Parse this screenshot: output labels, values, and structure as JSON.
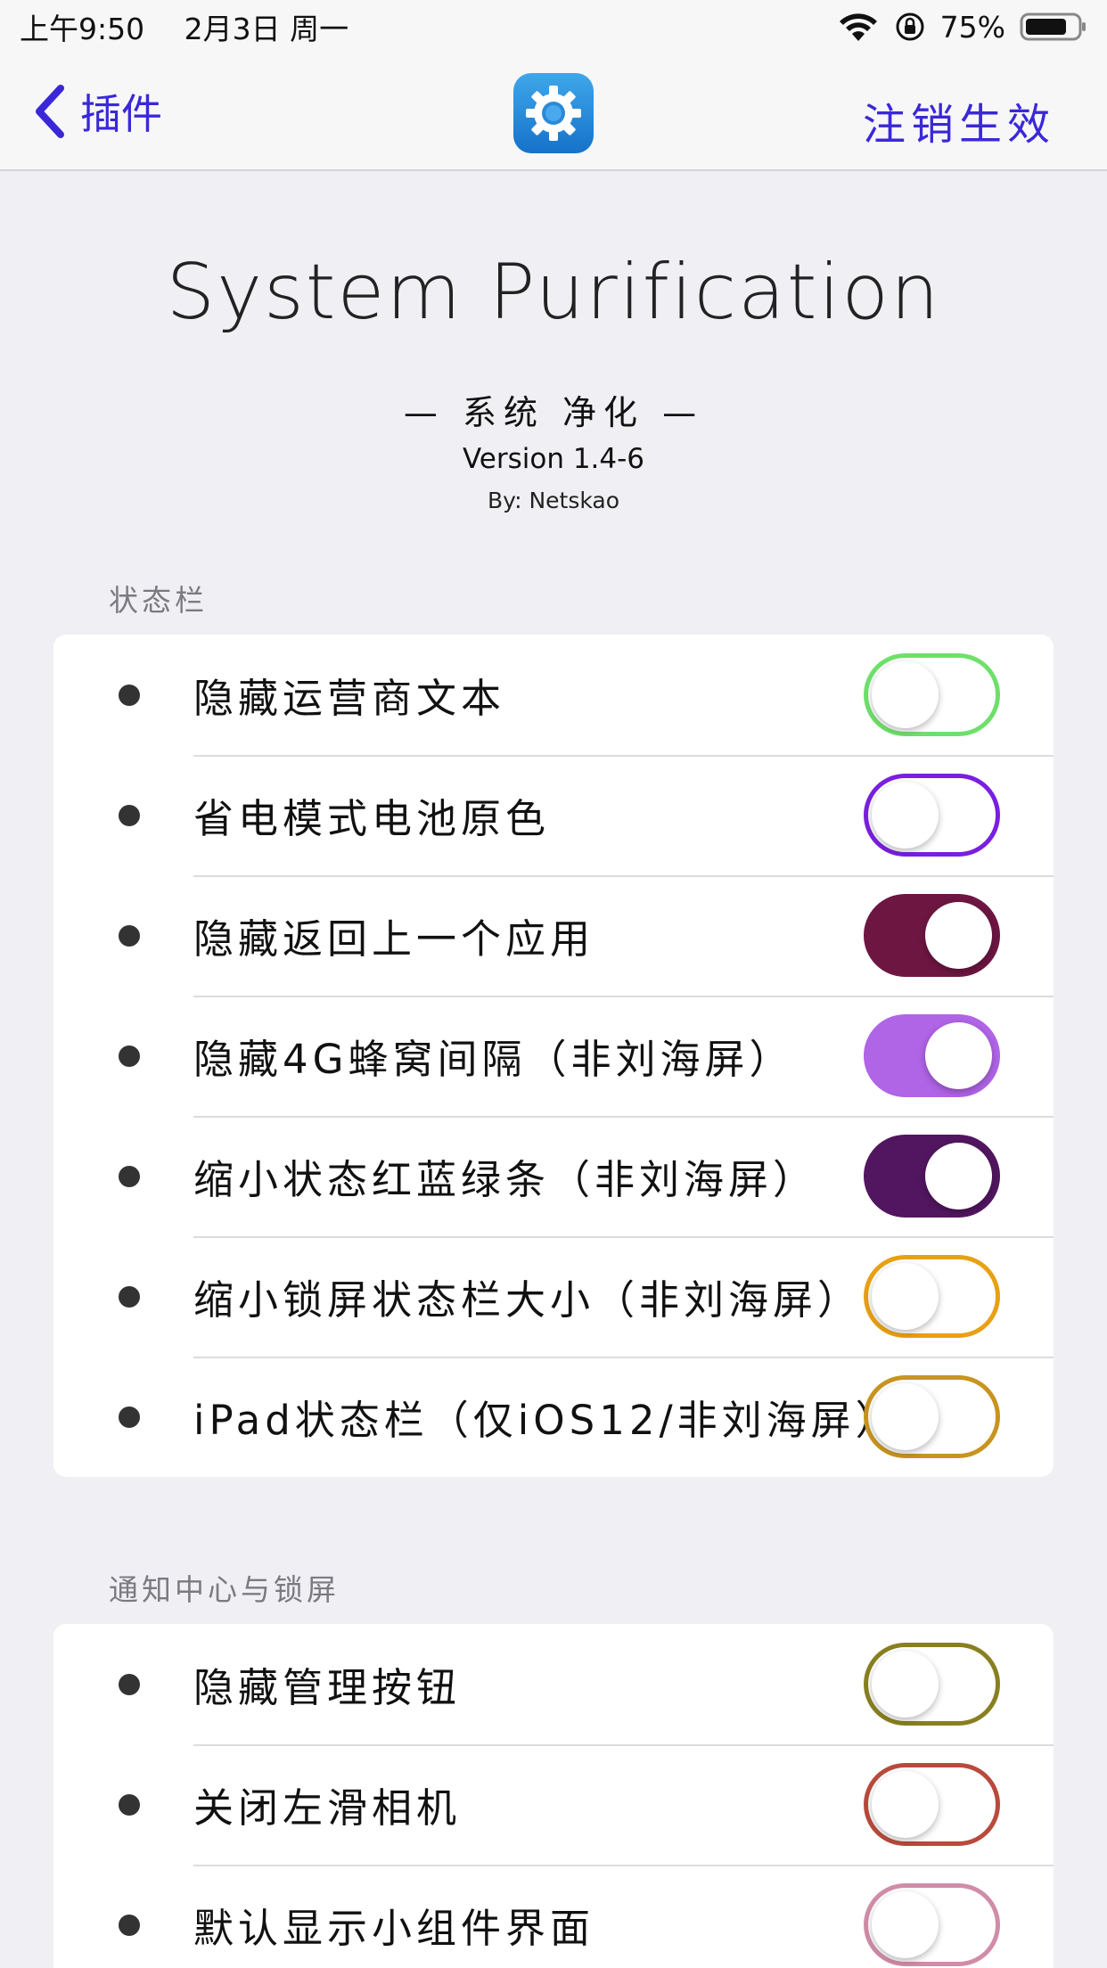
{
  "status_bar": {
    "time": "上午9:50",
    "date": "2月3日 周一",
    "battery": "75%"
  },
  "nav": {
    "back_label": "插件",
    "action_label": "注销生效",
    "app_icon": "gear-icon"
  },
  "header": {
    "title": "System Purification",
    "subtitle": "— 系统 净化 —",
    "version": "Version 1.4-6",
    "author": "By: Netskao"
  },
  "sections": [
    {
      "title": "状态栏",
      "items": [
        {
          "label": "隐藏运营商文本",
          "on": false,
          "color": "#6ee06a"
        },
        {
          "label": "省电模式电池原色",
          "on": false,
          "color": "#7a1fe0"
        },
        {
          "label": "隐藏返回上一个应用",
          "on": true,
          "color": "#6e1642"
        },
        {
          "label": "隐藏4G蜂窝间隔（非刘海屏）",
          "on": true,
          "color": "#b064e6"
        },
        {
          "label": "缩小状态红蓝绿条（非刘海屏）",
          "on": true,
          "color": "#521660"
        },
        {
          "label": "缩小锁屏状态栏大小（非刘海屏）",
          "on": false,
          "color": "#e8a014"
        },
        {
          "label": "iPad状态栏（仅iOS12/非刘海屏）",
          "on": false,
          "color": "#c89420"
        }
      ]
    },
    {
      "title": "通知中心与锁屏",
      "items": [
        {
          "label": "隐藏管理按钮",
          "on": false,
          "color": "#888020"
        },
        {
          "label": "关闭左滑相机",
          "on": false,
          "color": "#b84a3c"
        },
        {
          "label": "默认显示小组件界面",
          "on": false,
          "color": "#d08ca8"
        }
      ]
    }
  ]
}
